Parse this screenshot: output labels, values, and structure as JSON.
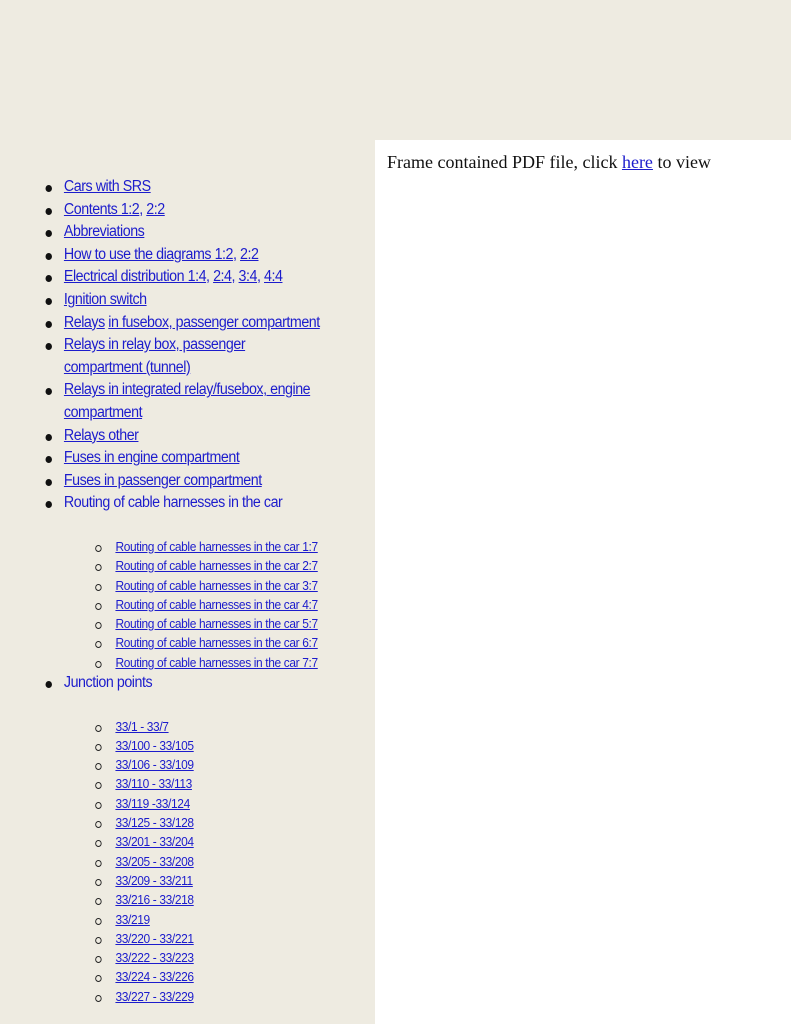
{
  "colors": {
    "background": "#eeebe1",
    "frame_background": "#ffffff",
    "link": "#1c1ccc",
    "text": "#111111"
  },
  "pdf_frame": {
    "message_before": "Frame contained PDF file, click ",
    "link_label": "here",
    "message_after": " to view"
  },
  "nav": {
    "items": [
      {
        "links": [
          "Cars with SRS"
        ]
      },
      {
        "links": [
          "Contents 1:2",
          "2:2"
        ]
      },
      {
        "links": [
          "Abbreviations"
        ]
      },
      {
        "links": [
          "How to use the diagrams 1:2",
          "2:2"
        ]
      },
      {
        "links": [
          "Electrical distribution 1:4",
          "2:4",
          "3:4",
          "4:4"
        ]
      },
      {
        "links": [
          "Ignition switch "
        ]
      },
      {
        "links": [
          "Relays",
          "in fusebox, passenger compartment "
        ]
      },
      {
        "links": [
          "Relays in relay box, passenger compartment (tunnel) "
        ]
      },
      {
        "links": [
          "Relays in integrated relay/fusebox, engine compartment "
        ]
      },
      {
        "links": [
          "Relays other "
        ]
      },
      {
        "links": [
          "Fuses in engine compartment"
        ]
      },
      {
        "links": [
          "Fuses in passenger compartment "
        ]
      }
    ],
    "routing": {
      "label": "Routing of cable harnesses in the car",
      "subitems": [
        "Routing of cable harnesses in the car 1:7",
        "Routing of cable harnesses in the car 2:7",
        "Routing of cable harnesses in the car 3:7",
        "Routing of cable harnesses in the car 4:7",
        "Routing of cable harnesses in the car 5:7",
        "Routing of cable harnesses in the car 6:7",
        "Routing of cable harnesses in the car 7:7"
      ]
    },
    "junction": {
      "label": "Junction points",
      "subitems": [
        "33/1 - 33/7",
        "33/100 - 33/105",
        "33/106 - 33/109",
        "33/110 - 33/113",
        "33/119 -33/124",
        "33/125 - 33/128",
        "33/201 - 33/204",
        "33/205 - 33/208",
        "33/209 - 33/211",
        "33/216 - 33/218",
        "33/219 ",
        "33/220 - 33/221",
        "33/222 - 33/223",
        "33/224 - 33/226",
        "33/227 - 33/229"
      ]
    }
  }
}
